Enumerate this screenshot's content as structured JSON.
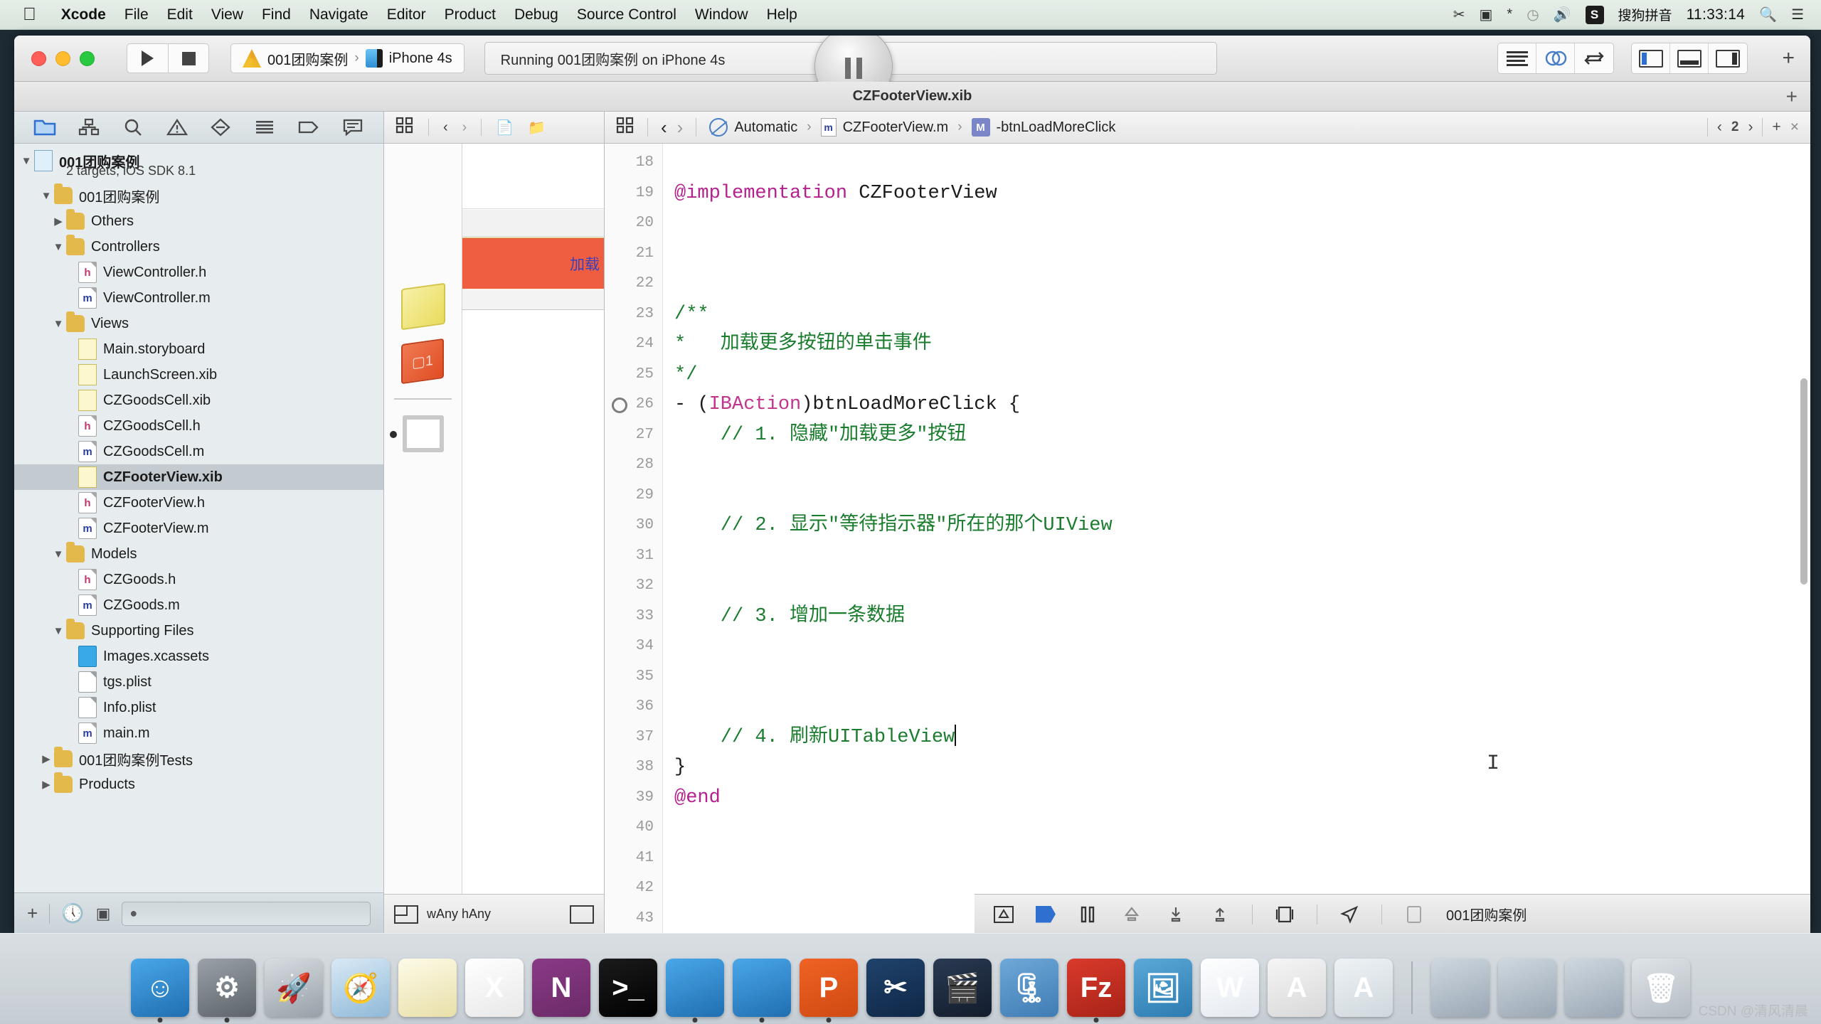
{
  "menubar": {
    "apple_icon": "apple-icon",
    "items": [
      {
        "label": "Xcode",
        "bold": true
      },
      {
        "label": "File",
        "bold": false
      },
      {
        "label": "Edit",
        "bold": false
      },
      {
        "label": "View",
        "bold": false
      },
      {
        "label": "Find",
        "bold": false
      },
      {
        "label": "Navigate",
        "bold": false
      },
      {
        "label": "Editor",
        "bold": false
      },
      {
        "label": "Product",
        "bold": false
      },
      {
        "label": "Debug",
        "bold": false
      },
      {
        "label": "Source Control",
        "bold": false
      },
      {
        "label": "Window",
        "bold": false
      },
      {
        "label": "Help",
        "bold": false
      }
    ],
    "status_icons": [
      "scissors-icon",
      "screen-record-icon",
      "bluetooth-icon",
      "time-machine-icon",
      "volume-icon"
    ],
    "input_method_badge": "S",
    "input_method_label": "搜狗拼音",
    "clock": "11:33:14",
    "search_icon": "search-icon",
    "notification_icon": "notification-center-icon"
  },
  "toolbar": {
    "run_icon": "run-icon",
    "stop_icon": "stop-icon",
    "scheme_project": "001团购案例",
    "scheme_separator": "›",
    "scheme_destination": "iPhone 4s",
    "status_text": "Running 001团购案例 on iPhone 4s",
    "pause_icon": "pause-icon",
    "editor_modes": [
      "standard-editor-icon",
      "assistant-editor-icon",
      "version-editor-icon"
    ],
    "panel_toggles": [
      "navigator-panel-icon",
      "debug-panel-icon",
      "utilities-panel-icon"
    ],
    "add_icon": "plus-icon"
  },
  "window": {
    "title": "CZFooterView.xib",
    "title_plus": "+"
  },
  "navigator": {
    "tabs": [
      "project-navigator-icon",
      "symbol-navigator-icon",
      "find-navigator-icon",
      "issue-navigator-icon",
      "test-navigator-icon",
      "debug-navigator-icon",
      "breakpoint-navigator-icon",
      "report-navigator-icon"
    ],
    "project_name": "001团购案例",
    "project_subtitle": "2 targets, iOS SDK 8.1",
    "tree": [
      {
        "label": "001团购案例",
        "indent": 2,
        "twisty": "open",
        "icon": "folder",
        "selected": false
      },
      {
        "label": "Others",
        "indent": 3,
        "twisty": "closed",
        "icon": "folder",
        "selected": false
      },
      {
        "label": "Controllers",
        "indent": 3,
        "twisty": "open",
        "icon": "folder",
        "selected": false
      },
      {
        "label": "ViewController.h",
        "indent": 4,
        "twisty": "none",
        "icon": "h",
        "selected": false
      },
      {
        "label": "ViewController.m",
        "indent": 4,
        "twisty": "none",
        "icon": "m",
        "selected": false
      },
      {
        "label": "Views",
        "indent": 3,
        "twisty": "open",
        "icon": "folder",
        "selected": false
      },
      {
        "label": "Main.storyboard",
        "indent": 4,
        "twisty": "none",
        "icon": "storyboard",
        "selected": false
      },
      {
        "label": "LaunchScreen.xib",
        "indent": 4,
        "twisty": "none",
        "icon": "xib",
        "selected": false
      },
      {
        "label": "CZGoodsCell.xib",
        "indent": 4,
        "twisty": "none",
        "icon": "xib",
        "selected": false
      },
      {
        "label": "CZGoodsCell.h",
        "indent": 4,
        "twisty": "none",
        "icon": "h",
        "selected": false
      },
      {
        "label": "CZGoodsCell.m",
        "indent": 4,
        "twisty": "none",
        "icon": "m",
        "selected": false
      },
      {
        "label": "CZFooterView.xib",
        "indent": 4,
        "twisty": "none",
        "icon": "xib",
        "selected": true
      },
      {
        "label": "CZFooterView.h",
        "indent": 4,
        "twisty": "none",
        "icon": "h",
        "selected": false
      },
      {
        "label": "CZFooterView.m",
        "indent": 4,
        "twisty": "none",
        "icon": "m",
        "selected": false
      },
      {
        "label": "Models",
        "indent": 3,
        "twisty": "open",
        "icon": "folder",
        "selected": false
      },
      {
        "label": "CZGoods.h",
        "indent": 4,
        "twisty": "none",
        "icon": "h",
        "selected": false
      },
      {
        "label": "CZGoods.m",
        "indent": 4,
        "twisty": "none",
        "icon": "m",
        "selected": false
      },
      {
        "label": "Supporting Files",
        "indent": 3,
        "twisty": "open",
        "icon": "folder",
        "selected": false
      },
      {
        "label": "Images.xcassets",
        "indent": 4,
        "twisty": "none",
        "icon": "xcassets",
        "selected": false
      },
      {
        "label": "tgs.plist",
        "indent": 4,
        "twisty": "none",
        "icon": "plist",
        "selected": false
      },
      {
        "label": "Info.plist",
        "indent": 4,
        "twisty": "none",
        "icon": "plist",
        "selected": false
      },
      {
        "label": "main.m",
        "indent": 4,
        "twisty": "none",
        "icon": "m",
        "selected": false
      },
      {
        "label": "001团购案例Tests",
        "indent": 2,
        "twisty": "closed",
        "icon": "folder",
        "selected": false
      },
      {
        "label": "Products",
        "indent": 2,
        "twisty": "closed",
        "icon": "folder",
        "selected": false
      }
    ],
    "footer": {
      "add_icon": "plus-icon",
      "recent_icon": "recent-files-icon",
      "source_control_icon": "source-control-filter-icon",
      "filter_placeholder": ""
    }
  },
  "interface_builder": {
    "jump_icons": [
      "related-items-icon",
      "back-arrow-icon",
      "forward-arrow-icon",
      "document-icon",
      "folder-icon"
    ],
    "dock_items": [
      "file-owner-cube-icon",
      "first-responder-cube-icon",
      "view-object-icon"
    ],
    "canvas_button_label": "加载",
    "footer": {
      "size_class_label": "wAny hAny",
      "size_class_icon": "size-class-icon",
      "layout_icon": "layout-icon"
    }
  },
  "editor": {
    "jump_bar": {
      "related_icon": "related-items-icon",
      "back_icon": "back-arrow-icon",
      "forward_icon": "forward-arrow-icon",
      "crumbs": [
        {
          "icon": "automatic-icon",
          "label": "Automatic"
        },
        {
          "icon": "m-file-icon",
          "label": "CZFooterView.m"
        },
        {
          "icon": "method-symbol-icon",
          "label": "-btnLoadMoreClick"
        }
      ],
      "sep": "›",
      "prev_issue_icon": "previous-icon",
      "issue_count": "2",
      "next_issue_icon": "next-icon",
      "add_editor_icon": "+",
      "close_editor_icon": "×"
    },
    "first_line_number": 18,
    "lines": [
      {
        "n": 18,
        "segments": []
      },
      {
        "n": 19,
        "segments": [
          {
            "t": "@implementation ",
            "c": "k-kw"
          },
          {
            "t": "CZFooterView",
            "c": ""
          }
        ]
      },
      {
        "n": 20,
        "segments": []
      },
      {
        "n": 21,
        "segments": []
      },
      {
        "n": 22,
        "segments": []
      },
      {
        "n": 23,
        "segments": [
          {
            "t": "/**",
            "c": "k-cmt"
          }
        ]
      },
      {
        "n": 24,
        "segments": [
          {
            "t": "*   加载更多按钮的单击事件",
            "c": "k-cmt"
          }
        ]
      },
      {
        "n": 25,
        "segments": [
          {
            "t": "*/",
            "c": "k-cmt"
          }
        ]
      },
      {
        "n": 26,
        "segments": [
          {
            "t": "- (",
            "c": ""
          },
          {
            "t": "IBAction",
            "c": "k-type"
          },
          {
            "t": ")btnLoadMoreClick {",
            "c": ""
          }
        ],
        "breakpoint": true
      },
      {
        "n": 27,
        "segments": [
          {
            "t": "    // 1. 隐藏\"加载更多\"按钮",
            "c": "k-cmt"
          }
        ]
      },
      {
        "n": 28,
        "segments": []
      },
      {
        "n": 29,
        "segments": []
      },
      {
        "n": 30,
        "segments": [
          {
            "t": "    // 2. 显示\"等待指示器\"所在的那个UIView",
            "c": "k-cmt"
          }
        ]
      },
      {
        "n": 31,
        "segments": []
      },
      {
        "n": 32,
        "segments": []
      },
      {
        "n": 33,
        "segments": [
          {
            "t": "    // 3. 增加一条数据",
            "c": "k-cmt"
          }
        ]
      },
      {
        "n": 34,
        "segments": []
      },
      {
        "n": 35,
        "segments": []
      },
      {
        "n": 36,
        "segments": []
      },
      {
        "n": 37,
        "segments": [
          {
            "t": "    // 4. 刷新UITableView",
            "c": "k-cmt"
          }
        ],
        "caret": true
      },
      {
        "n": 38,
        "segments": [
          {
            "t": "}",
            "c": ""
          }
        ]
      },
      {
        "n": 39,
        "segments": [
          {
            "t": "@end",
            "c": "k-kw"
          }
        ]
      },
      {
        "n": 40,
        "segments": []
      },
      {
        "n": 41,
        "segments": []
      },
      {
        "n": 42,
        "segments": []
      },
      {
        "n": 43,
        "segments": []
      }
    ]
  },
  "debug_bar": {
    "icons": [
      "hide-debug-area-icon",
      "continue-icon",
      "pause-icon",
      "step-over-icon",
      "step-into-icon",
      "step-out-icon",
      "view-hierarchy-icon",
      "location-icon"
    ],
    "process_icon": "process-icon",
    "process_label": "001团购案例"
  },
  "dock": {
    "items": [
      {
        "name": "finder-icon",
        "glyph": "☺",
        "bg1": "#4aa7e8",
        "bg2": "#1f6fb2",
        "running": true
      },
      {
        "name": "system-preferences-icon",
        "glyph": "⚙",
        "bg1": "#9aa1a8",
        "bg2": "#5c6369",
        "running": true
      },
      {
        "name": "launchpad-icon",
        "glyph": "🚀",
        "bg1": "#d8dde2",
        "bg2": "#97a0a8",
        "running": false
      },
      {
        "name": "safari-icon",
        "glyph": "🧭",
        "bg1": "#d9e9f5",
        "bg2": "#8fb9d8",
        "running": false
      },
      {
        "name": "notes-icon",
        "glyph": "",
        "bg1": "#fdfbe8",
        "bg2": "#e8dfa8",
        "running": false
      },
      {
        "name": "excel-icon",
        "glyph": "X",
        "bg1": "#ffffff",
        "bg2": "#e8e8e8",
        "running": false
      },
      {
        "name": "onenote-icon",
        "glyph": "N",
        "bg1": "#8a3a86",
        "bg2": "#6b2a68",
        "running": false
      },
      {
        "name": "terminal-icon",
        "glyph": ">_",
        "bg1": "#1b1b1b",
        "bg2": "#000000",
        "running": false
      },
      {
        "name": "xcode-icon",
        "glyph": "",
        "bg1": "#4aa7e8",
        "bg2": "#1f6fb2",
        "running": true
      },
      {
        "name": "simulator-icon",
        "glyph": "",
        "bg1": "#4aa7e8",
        "bg2": "#1f6fb2",
        "running": true
      },
      {
        "name": "powerpoint-icon",
        "glyph": "P",
        "bg1": "#f06224",
        "bg2": "#cf4a12",
        "running": true
      },
      {
        "name": "snipaste-icon",
        "glyph": "✂",
        "bg1": "#20436b",
        "bg2": "#0f2747",
        "running": false
      },
      {
        "name": "quicktime-icon",
        "glyph": "🎬",
        "bg1": "#2a3a52",
        "bg2": "#121c2c",
        "running": false
      },
      {
        "name": "keka-icon",
        "glyph": "🗜",
        "bg1": "#6fa8d8",
        "bg2": "#3f7cb4",
        "running": false
      },
      {
        "name": "filezilla-icon",
        "glyph": "Fz",
        "bg1": "#d93a2b",
        "bg2": "#a82318",
        "running": true
      },
      {
        "name": "preview-icon",
        "glyph": "🖼",
        "bg1": "#5aa9d8",
        "bg2": "#2d7bb0",
        "running": false
      },
      {
        "name": "word-icon",
        "glyph": "W",
        "bg1": "#ffffff",
        "bg2": "#e4e9f0",
        "running": false
      },
      {
        "name": "font-book-icon",
        "glyph": "A",
        "bg1": "#f5f5f5",
        "bg2": "#d8d8d8",
        "running": false
      },
      {
        "name": "fontforge-icon",
        "glyph": "A",
        "bg1": "#eef2f5",
        "bg2": "#cfd8de",
        "running": false
      }
    ],
    "right_items": [
      {
        "name": "stacks-folder-icon",
        "glyph": "",
        "bg1": "#cfd8e0",
        "bg2": "#9aa7b4"
      },
      {
        "name": "downloads-folder-icon",
        "glyph": "",
        "bg1": "#cfd8e0",
        "bg2": "#9aa7b4"
      },
      {
        "name": "documents-folder-icon",
        "glyph": "",
        "bg1": "#cfd8e0",
        "bg2": "#9aa7b4"
      },
      {
        "name": "trash-icon",
        "glyph": "🗑",
        "bg1": "#dfe4e8",
        "bg2": "#b4bcc4"
      }
    ]
  },
  "watermark": "CSDN @清风清晨"
}
